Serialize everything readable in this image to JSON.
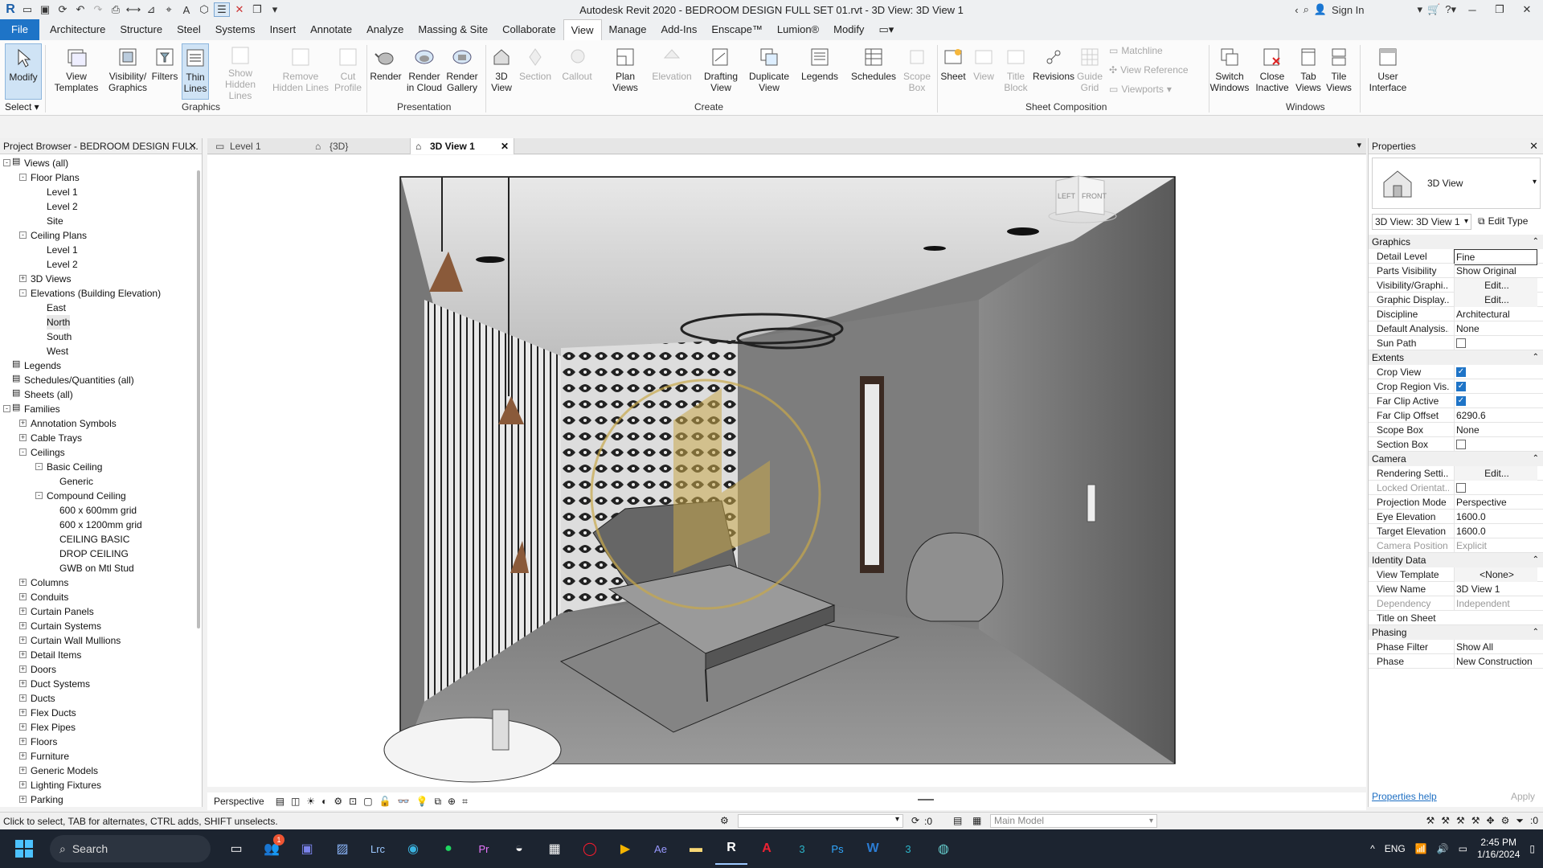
{
  "window": {
    "title": "Autodesk Revit 2020 - BEDROOM DESIGN FULL SET 01.rvt - 3D View: 3D View 1",
    "sign_in": "Sign In"
  },
  "menu": {
    "items": [
      "File",
      "Architecture",
      "Structure",
      "Steel",
      "Systems",
      "Insert",
      "Annotate",
      "Analyze",
      "Massing & Site",
      "Collaborate",
      "View",
      "Manage",
      "Add-Ins",
      "Enscape™",
      "Lumion®",
      "Modify"
    ],
    "active": "View"
  },
  "ribbon": {
    "modify": "Modify",
    "select": "Select ▾",
    "graphics": {
      "view_templates": "View Templates",
      "visibility": "Visibility/ Graphics",
      "filters": "Filters",
      "thin_lines": "Thin Lines",
      "show_hidden": "Show Hidden Lines",
      "remove_hidden": "Remove Hidden Lines",
      "cut_profile": "Cut Profile",
      "label": "Graphics"
    },
    "presentation": {
      "render": "Render",
      "render_cloud": "Render in Cloud",
      "render_gallery": "Render Gallery",
      "label": "Presentation"
    },
    "create": {
      "view3d": "3D View",
      "section": "Section",
      "callout": "Callout",
      "plan_views": "Plan Views",
      "elevation": "Elevation",
      "drafting": "Drafting View",
      "duplicate": "Duplicate View",
      "legends": "Legends",
      "schedules": "Schedules",
      "scope_box": "Scope Box",
      "label": "Create"
    },
    "sheet": {
      "sheet": "Sheet",
      "view": "View",
      "title_block": "Title Block",
      "revisions": "Revisions",
      "guide_grid": "Guide Grid",
      "matchline": "Matchline",
      "view_reference": "View Reference",
      "viewports": "Viewports",
      "label": "Sheet Composition"
    },
    "windows": {
      "switch": "Switch Windows",
      "close_inactive": "Close Inactive",
      "tab_views": "Tab Views",
      "tile_views": "Tile Views",
      "user_interface": "User Interface",
      "label": "Windows"
    }
  },
  "project_browser": {
    "title": "Project Browser - BEDROOM DESIGN FUL...",
    "nodes": [
      {
        "label": "Views (all)",
        "level": 0,
        "toggle": "-"
      },
      {
        "label": "Floor Plans",
        "level": 1,
        "toggle": "-"
      },
      {
        "label": "Level 1",
        "level": 2,
        "toggle": ""
      },
      {
        "label": "Level 2",
        "level": 2,
        "toggle": ""
      },
      {
        "label": "Site",
        "level": 2,
        "toggle": ""
      },
      {
        "label": "Ceiling Plans",
        "level": 1,
        "toggle": "-"
      },
      {
        "label": "Level 1",
        "level": 2,
        "toggle": ""
      },
      {
        "label": "Level 2",
        "level": 2,
        "toggle": ""
      },
      {
        "label": "3D Views",
        "level": 1,
        "toggle": "+"
      },
      {
        "label": "Elevations (Building Elevation)",
        "level": 1,
        "toggle": "-"
      },
      {
        "label": "East",
        "level": 2,
        "toggle": ""
      },
      {
        "label": "North",
        "level": 2,
        "toggle": ""
      },
      {
        "label": "South",
        "level": 2,
        "toggle": ""
      },
      {
        "label": "West",
        "level": 2,
        "toggle": ""
      },
      {
        "label": "Legends",
        "level": 0,
        "toggle": ""
      },
      {
        "label": "Schedules/Quantities (all)",
        "level": 0,
        "toggle": ""
      },
      {
        "label": "Sheets (all)",
        "level": 0,
        "toggle": ""
      },
      {
        "label": "Families",
        "level": 0,
        "toggle": "-"
      },
      {
        "label": "Annotation Symbols",
        "level": 1,
        "toggle": "+"
      },
      {
        "label": "Cable Trays",
        "level": 1,
        "toggle": "+"
      },
      {
        "label": "Ceilings",
        "level": 1,
        "toggle": "-"
      },
      {
        "label": "Basic Ceiling",
        "level": 2,
        "toggle": "-"
      },
      {
        "label": "Generic",
        "level": 3,
        "toggle": ""
      },
      {
        "label": "Compound Ceiling",
        "level": 2,
        "toggle": "-"
      },
      {
        "label": "600 x 600mm grid",
        "level": 3,
        "toggle": ""
      },
      {
        "label": "600 x 1200mm grid",
        "level": 3,
        "toggle": ""
      },
      {
        "label": "CEILING BASIC",
        "level": 3,
        "toggle": ""
      },
      {
        "label": "DROP CEILING",
        "level": 3,
        "toggle": ""
      },
      {
        "label": "GWB on Mtl Stud",
        "level": 3,
        "toggle": ""
      },
      {
        "label": "Columns",
        "level": 1,
        "toggle": "+"
      },
      {
        "label": "Conduits",
        "level": 1,
        "toggle": "+"
      },
      {
        "label": "Curtain Panels",
        "level": 1,
        "toggle": "+"
      },
      {
        "label": "Curtain Systems",
        "level": 1,
        "toggle": "+"
      },
      {
        "label": "Curtain Wall Mullions",
        "level": 1,
        "toggle": "+"
      },
      {
        "label": "Detail Items",
        "level": 1,
        "toggle": "+"
      },
      {
        "label": "Doors",
        "level": 1,
        "toggle": "+"
      },
      {
        "label": "Duct Systems",
        "level": 1,
        "toggle": "+"
      },
      {
        "label": "Ducts",
        "level": 1,
        "toggle": "+"
      },
      {
        "label": "Flex Ducts",
        "level": 1,
        "toggle": "+"
      },
      {
        "label": "Flex Pipes",
        "level": 1,
        "toggle": "+"
      },
      {
        "label": "Floors",
        "level": 1,
        "toggle": "+"
      },
      {
        "label": "Furniture",
        "level": 1,
        "toggle": "+"
      },
      {
        "label": "Generic Models",
        "level": 1,
        "toggle": "+"
      },
      {
        "label": "Lighting Fixtures",
        "level": 1,
        "toggle": "+"
      },
      {
        "label": "Parking",
        "level": 1,
        "toggle": "+"
      }
    ]
  },
  "tabs": [
    {
      "label": "Level 1",
      "active": false
    },
    {
      "label": "{3D}",
      "active": false
    },
    {
      "label": "3D View 1",
      "active": true
    }
  ],
  "viewcube": {
    "left": "LEFT",
    "front": "FRONT"
  },
  "view_control": {
    "mode": "Perspective"
  },
  "properties": {
    "title": "Properties",
    "type_name": "3D View",
    "selector": "3D View: 3D View 1",
    "edit_type": "Edit Type",
    "categories": [
      {
        "name": "Graphics",
        "rows": [
          {
            "label": "Detail Level",
            "value": "Fine"
          },
          {
            "label": "Parts Visibility",
            "value": "Show Original"
          },
          {
            "label": "Visibility/Graphi...",
            "value": "Edit..."
          },
          {
            "label": "Graphic Display...",
            "value": "Edit..."
          },
          {
            "label": "Discipline",
            "value": "Architectural"
          },
          {
            "label": "Default Analysis...",
            "value": "None"
          },
          {
            "label": "Sun Path",
            "value": "",
            "check": false
          }
        ]
      },
      {
        "name": "Extents",
        "rows": [
          {
            "label": "Crop View",
            "value": "",
            "check": true
          },
          {
            "label": "Crop Region Vis...",
            "value": "",
            "check": true
          },
          {
            "label": "Far Clip Active",
            "value": "",
            "check": true
          },
          {
            "label": "Far Clip Offset",
            "value": "6290.6"
          },
          {
            "label": "Scope Box",
            "value": "None"
          },
          {
            "label": "Section Box",
            "value": "",
            "check": false
          }
        ]
      },
      {
        "name": "Camera",
        "rows": [
          {
            "label": "Rendering Setti...",
            "value": "Edit..."
          },
          {
            "label": "Locked Orientat...",
            "value": "",
            "check": false
          },
          {
            "label": "Projection Mode",
            "value": "Perspective"
          },
          {
            "label": "Eye Elevation",
            "value": "1600.0"
          },
          {
            "label": "Target Elevation",
            "value": "1600.0"
          },
          {
            "label": "Camera Position",
            "value": "Explicit"
          }
        ]
      },
      {
        "name": "Identity Data",
        "rows": [
          {
            "label": "View Template",
            "value": "<None>"
          },
          {
            "label": "View Name",
            "value": "3D View 1"
          },
          {
            "label": "Dependency",
            "value": "Independent"
          },
          {
            "label": "Title on Sheet",
            "value": ""
          }
        ]
      },
      {
        "name": "Phasing",
        "rows": [
          {
            "label": "Phase Filter",
            "value": "Show All"
          },
          {
            "label": "Phase",
            "value": "New Construction"
          }
        ]
      }
    ],
    "help": "Properties help",
    "apply": "Apply"
  },
  "status": {
    "message": "Click to select, TAB for alternates, CTRL adds, SHIFT unselects.",
    "count": ":0",
    "model": "Main Model",
    "filter": ":0"
  },
  "taskbar": {
    "search": "Search",
    "lang": "ENG",
    "time": "2:45 PM",
    "date": "1/16/2024",
    "badge": "1"
  }
}
